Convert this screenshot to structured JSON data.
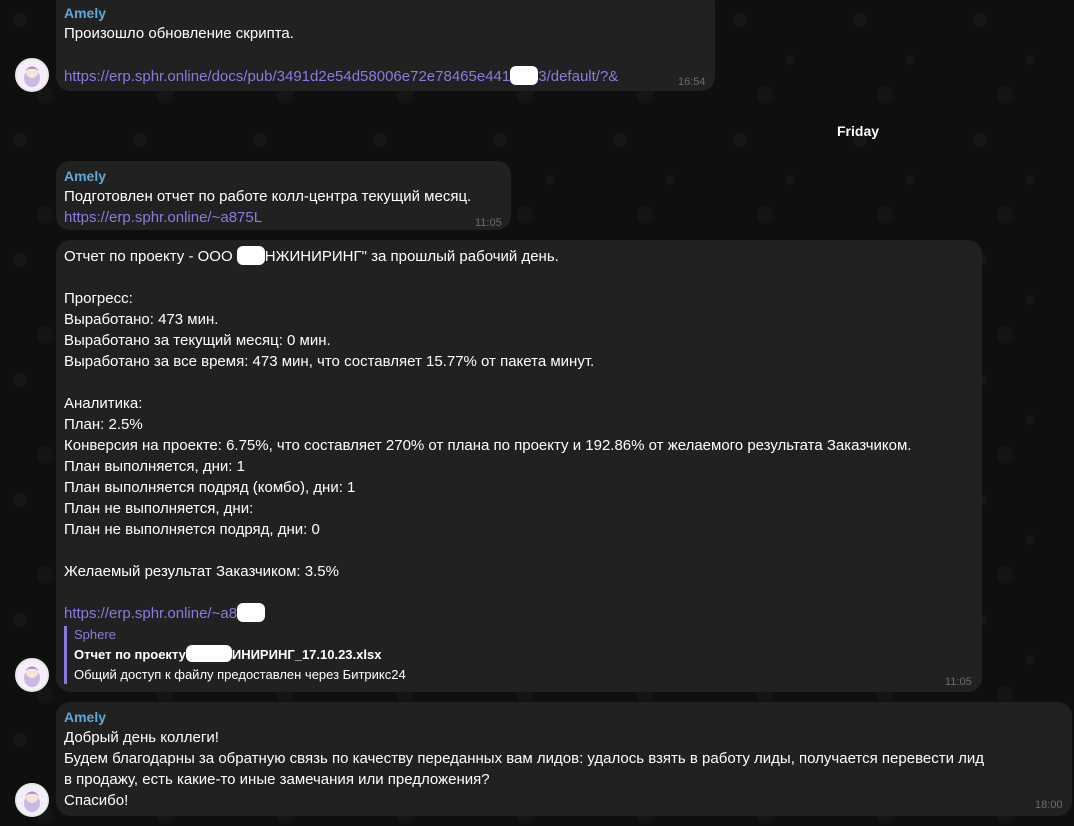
{
  "day_separator": "Friday",
  "messages": [
    {
      "sender": "Amely",
      "lines": [
        "Произошло обновление скрипта."
      ],
      "link_prefix": "https://erp.sphr.online/docs/pub/3491d2e54d58006e72e78465e441",
      "link_suffix": "3/default/?&",
      "time": "16:54"
    },
    {
      "sender": "Amely",
      "lines": [
        "Подготовлен отчет по работе колл-центра текущий месяц."
      ],
      "link": "https://erp.sphr.online/~a875L",
      "time": "11:05"
    },
    {
      "title_prefix": "Отчет по проекту - ООО",
      "title_suffix": "НЖИНИРИНГ\" за прошлый рабочий день.",
      "lines": [
        "Прогресс:",
        "Выработано: 473 мин.",
        "Выработано за текущий месяц: 0 мин.",
        "Выработано за все время: 473 мин, что составляет 15.77% от пакета минут.",
        "Аналитика:",
        "План: 2.5%",
        "Конверсия на проекте: 6.75%, что составляет 270% от плана по проекту и 192.86% от желаемого результата Заказчиком.",
        "План выполняется, дни: 1",
        "План выполняется подряд (комбо), дни: 1",
        "План не выполняется, дни:",
        "План не выполняется подряд, дни: 0",
        "Желаемый результат Заказчиком: 3.5%"
      ],
      "link_prefix": "https://erp.sphr.online/~a8",
      "preview": {
        "sender": "Sphere",
        "title_prefix": "Отчет по проекту",
        "title_suffix": "ИНИРИНГ_17.10.23.xlsx",
        "text": "Общий доступ к файлу предоставлен через Битрикс24"
      },
      "time": "11:05"
    },
    {
      "sender": "Amely",
      "lines": [
        "Добрый день коллеги!",
        "Будем благодарны за обратную связь по качеству переданных вам лидов: удалось взять в работу лиды, получается перевести лид",
        "в продажу, есть какие-то иные замечания или предложения?",
        "Спасибо!"
      ],
      "time": "18:00"
    }
  ],
  "colors": {
    "background": "#0f0f0f",
    "bubble": "#212121",
    "sender": "#5fa8d9",
    "link": "#8a7be0",
    "time": "#6c6c6c"
  },
  "icons": {
    "avatar": "avatar-cartoon-icon"
  }
}
